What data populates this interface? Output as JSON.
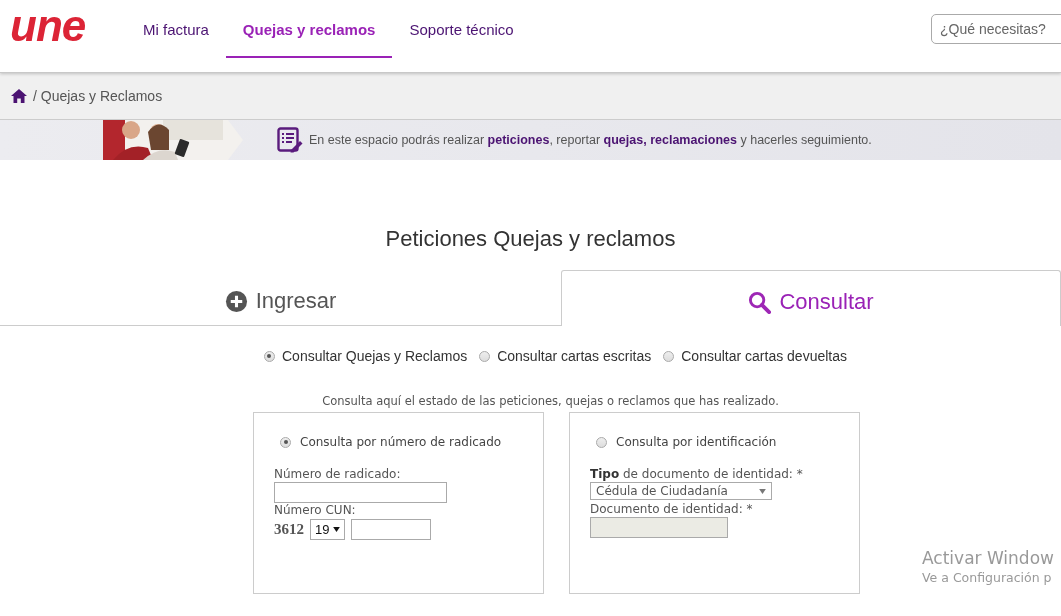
{
  "logo": {
    "text": "une"
  },
  "nav": [
    {
      "label": "Mi factura",
      "selected": false
    },
    {
      "label": "Quejas y reclamos",
      "selected": true
    },
    {
      "label": "Soporte técnico",
      "selected": false
    }
  ],
  "search": {
    "placeholder": "¿Qué necesitas?"
  },
  "breadcrumb": {
    "items": [
      "/ Quejas y Reclamos"
    ]
  },
  "banner": {
    "text": "En este espacio podrás realizar **peticiones**, reportar **quejas, reclamaciones** y hacerles seguimiento."
  },
  "title": "Peticiones Quejas y reclamos",
  "tabs": [
    {
      "label": "Ingresar",
      "kind": "add",
      "selected": false
    },
    {
      "label": "Consultar",
      "kind": "query",
      "selected": true
    }
  ],
  "options": [
    {
      "label": "Consultar Quejas y Reclamos",
      "selected": true
    },
    {
      "label": "Consultar cartas escritas",
      "selected": false
    },
    {
      "label": "Consultar cartas devueltas",
      "selected": false
    }
  ],
  "caption": "Consulta aquí el estado de las peticiones, quejas o reclamos que has realizado.",
  "panels": [
    {
      "radio": {
        "label": "Consulta por número de radicado",
        "selected": true
      },
      "fields": [
        {
          "kind": "text",
          "label": "Número de radicado:"
        },
        {
          "kind": "cun",
          "label": "Número CUN:",
          "prefix": "3612",
          "select": "19"
        }
      ]
    },
    {
      "radio": {
        "label": "Consulta por identificación",
        "selected": false
      },
      "fields": [
        {
          "kind": "select",
          "label": "**Tipo** de documento de identidad: *",
          "value": "Cédula de Ciudadanía"
        },
        {
          "kind": "text",
          "label": "Documento de identidad: *",
          "disabled": true
        }
      ]
    }
  ],
  "os_notice": {
    "title": "Activar Window",
    "subtitle": "Ve a Configuración p"
  }
}
